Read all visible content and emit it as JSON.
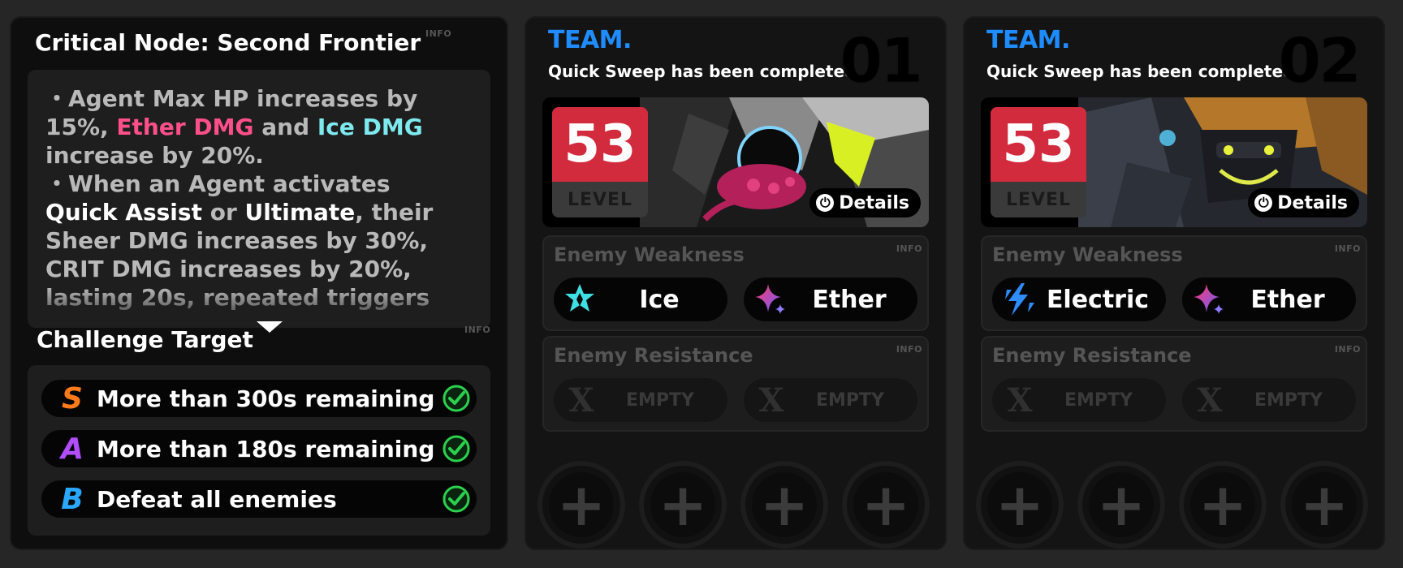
{
  "node": {
    "title": "Critical Node: Second Frontier",
    "info": "INFO",
    "description": {
      "b1_a": "Agent Max HP increases by 15%, ",
      "b1_ether": "Ether DMG",
      "b1_b": " and ",
      "b1_ice": "Ice DMG",
      "b1_c": " increase by 20%.",
      "b2_a": "When an Agent activates ",
      "b2_qa": "Quick Assist",
      "b2_b": " or ",
      "b2_ult": "Ultimate",
      "b2_c": ", their Sheer DMG increases by 30%, CRIT DMG increases by 20%, lasting 20s, repeated triggers"
    }
  },
  "challenge": {
    "title": "Challenge Target",
    "info": "INFO",
    "targets": [
      {
        "rank": "S",
        "label": "More than 300s remaining",
        "color": "#ff7a1a"
      },
      {
        "rank": "A",
        "label": "More than 180s remaining",
        "color": "#b24dff"
      },
      {
        "rank": "B",
        "label": "Defeat all enemies",
        "color": "#2aa7ff"
      }
    ]
  },
  "teams": [
    {
      "name": "TEAM.",
      "status": "Quick Sweep has been completed",
      "number": "01",
      "level": "53",
      "level_label": "LEVEL",
      "details": "Details",
      "weakness_title": "Enemy Weakness",
      "weaknesses": [
        "Ice",
        "Ether"
      ],
      "resistance_title": "Enemy Resistance",
      "resistances": [
        "EMPTY",
        "EMPTY"
      ],
      "info": "INFO"
    },
    {
      "name": "TEAM.",
      "status": "Quick Sweep has been completed",
      "number": "02",
      "level": "53",
      "level_label": "LEVEL",
      "details": "Details",
      "weakness_title": "Enemy Weakness",
      "weaknesses": [
        "Electric",
        "Ether"
      ],
      "resistance_title": "Enemy Resistance",
      "resistances": [
        "EMPTY",
        "EMPTY"
      ],
      "info": "INFO"
    }
  ],
  "icons": {
    "ice": "ice-element-icon",
    "ether": "ether-element-icon",
    "electric": "electric-element-icon",
    "check": "check-circle-icon",
    "add": "plus-icon",
    "details": "power-icon"
  },
  "colors": {
    "team_accent": "#1e8cff",
    "level_red": "#d22b3e",
    "ether_text": "#ff4f8b",
    "ice_text": "#7ee9ee",
    "check_green": "#2bd14d"
  }
}
